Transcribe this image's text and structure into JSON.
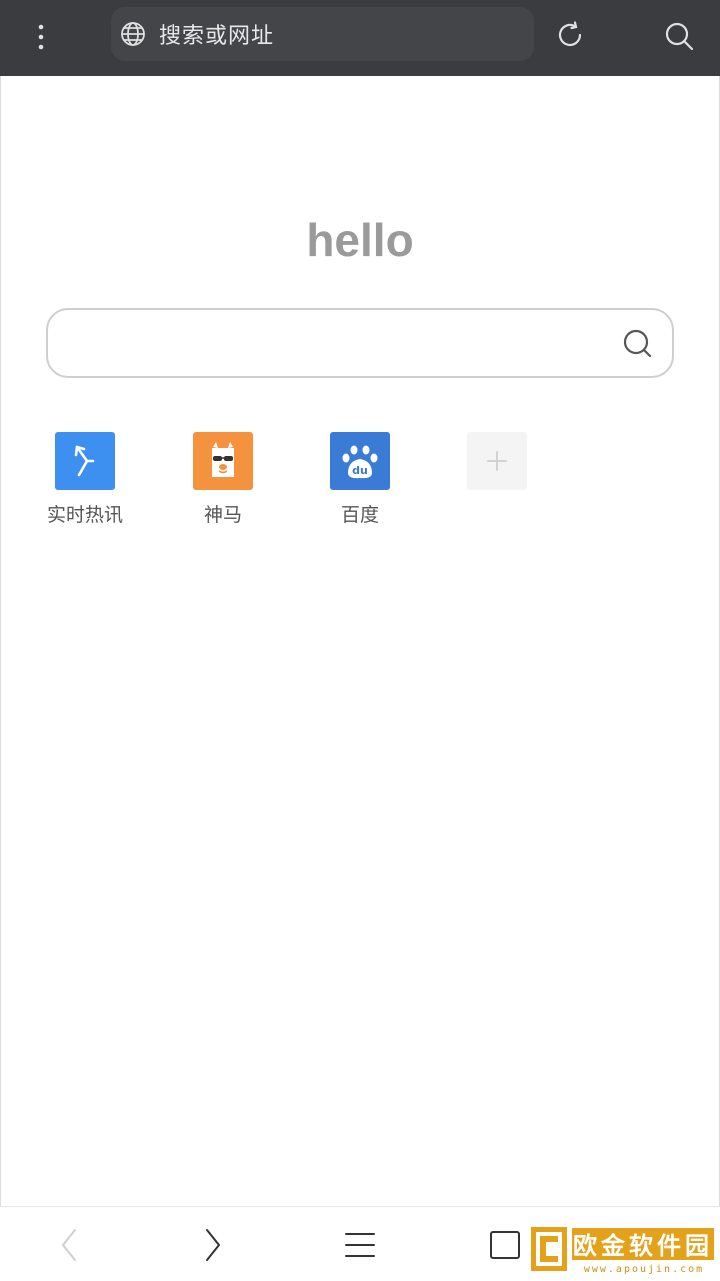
{
  "topbar": {
    "address_placeholder": "搜索或网址"
  },
  "home": {
    "greeting": "hello",
    "search_placeholder": ""
  },
  "shortcuts": [
    {
      "label": "实时热讯",
      "icon": "lightning-arrow-icon",
      "color": "#3d8ff0"
    },
    {
      "label": "神马",
      "icon": "alpaca-icon",
      "color": "#f5923e"
    },
    {
      "label": "百度",
      "icon": "baidu-paw-icon",
      "color": "#3a7bd5"
    },
    {
      "label": "",
      "icon": "plus-icon",
      "color": "#f4f4f4"
    }
  ],
  "bottom_nav": {
    "items": [
      "back-icon",
      "forward-icon",
      "menu-icon",
      "tabs-icon",
      "home-icon"
    ]
  },
  "watermark": {
    "text": "欧金软件园",
    "url": "www.apoujin.com"
  },
  "colors": {
    "topbar_bg": "#3b3c40",
    "address_bg": "#444549",
    "greeting": "#9a9a9a"
  }
}
